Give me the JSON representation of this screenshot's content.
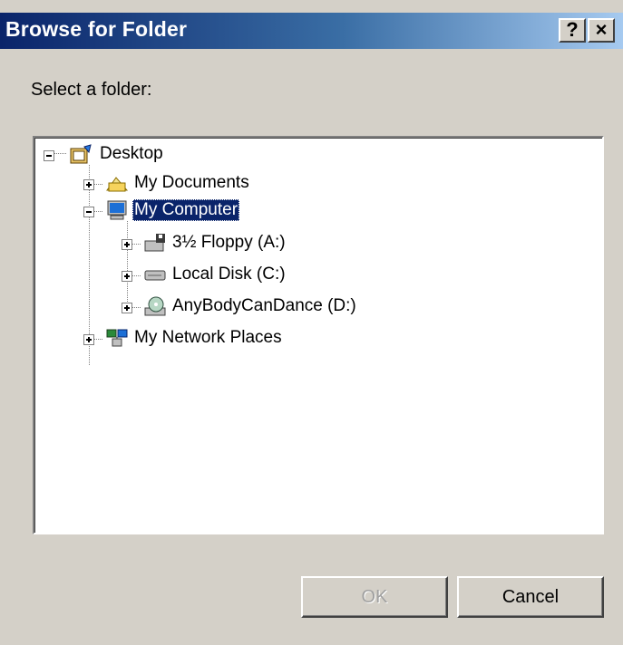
{
  "window": {
    "title": "Browse for Folder",
    "help_label": "?",
    "close_label": "×"
  },
  "prompt": "Select a folder:",
  "tree": {
    "items": [
      {
        "label": "Desktop",
        "icon": "desktop-icon",
        "expanded": true
      },
      {
        "label": "My Documents",
        "icon": "my-documents-folder-icon",
        "expanded": false
      },
      {
        "label": "My Computer",
        "icon": "my-computer-icon",
        "expanded": true,
        "selected": true
      },
      {
        "label": "3½ Floppy (A:)",
        "icon": "floppy-drive-icon",
        "expanded": false
      },
      {
        "label": "Local Disk (C:)",
        "icon": "hard-disk-icon",
        "expanded": false
      },
      {
        "label": "AnyBodyCanDance (D:)",
        "icon": "cd-drive-icon",
        "expanded": false
      },
      {
        "label": "My Network Places",
        "icon": "network-places-icon",
        "expanded": false
      }
    ]
  },
  "buttons": {
    "ok": "OK",
    "cancel": "Cancel"
  },
  "colors": {
    "titlebar_start": "#0a246a",
    "titlebar_end": "#a6caf0",
    "selection": "#0a246a",
    "face": "#d4d0c8"
  }
}
